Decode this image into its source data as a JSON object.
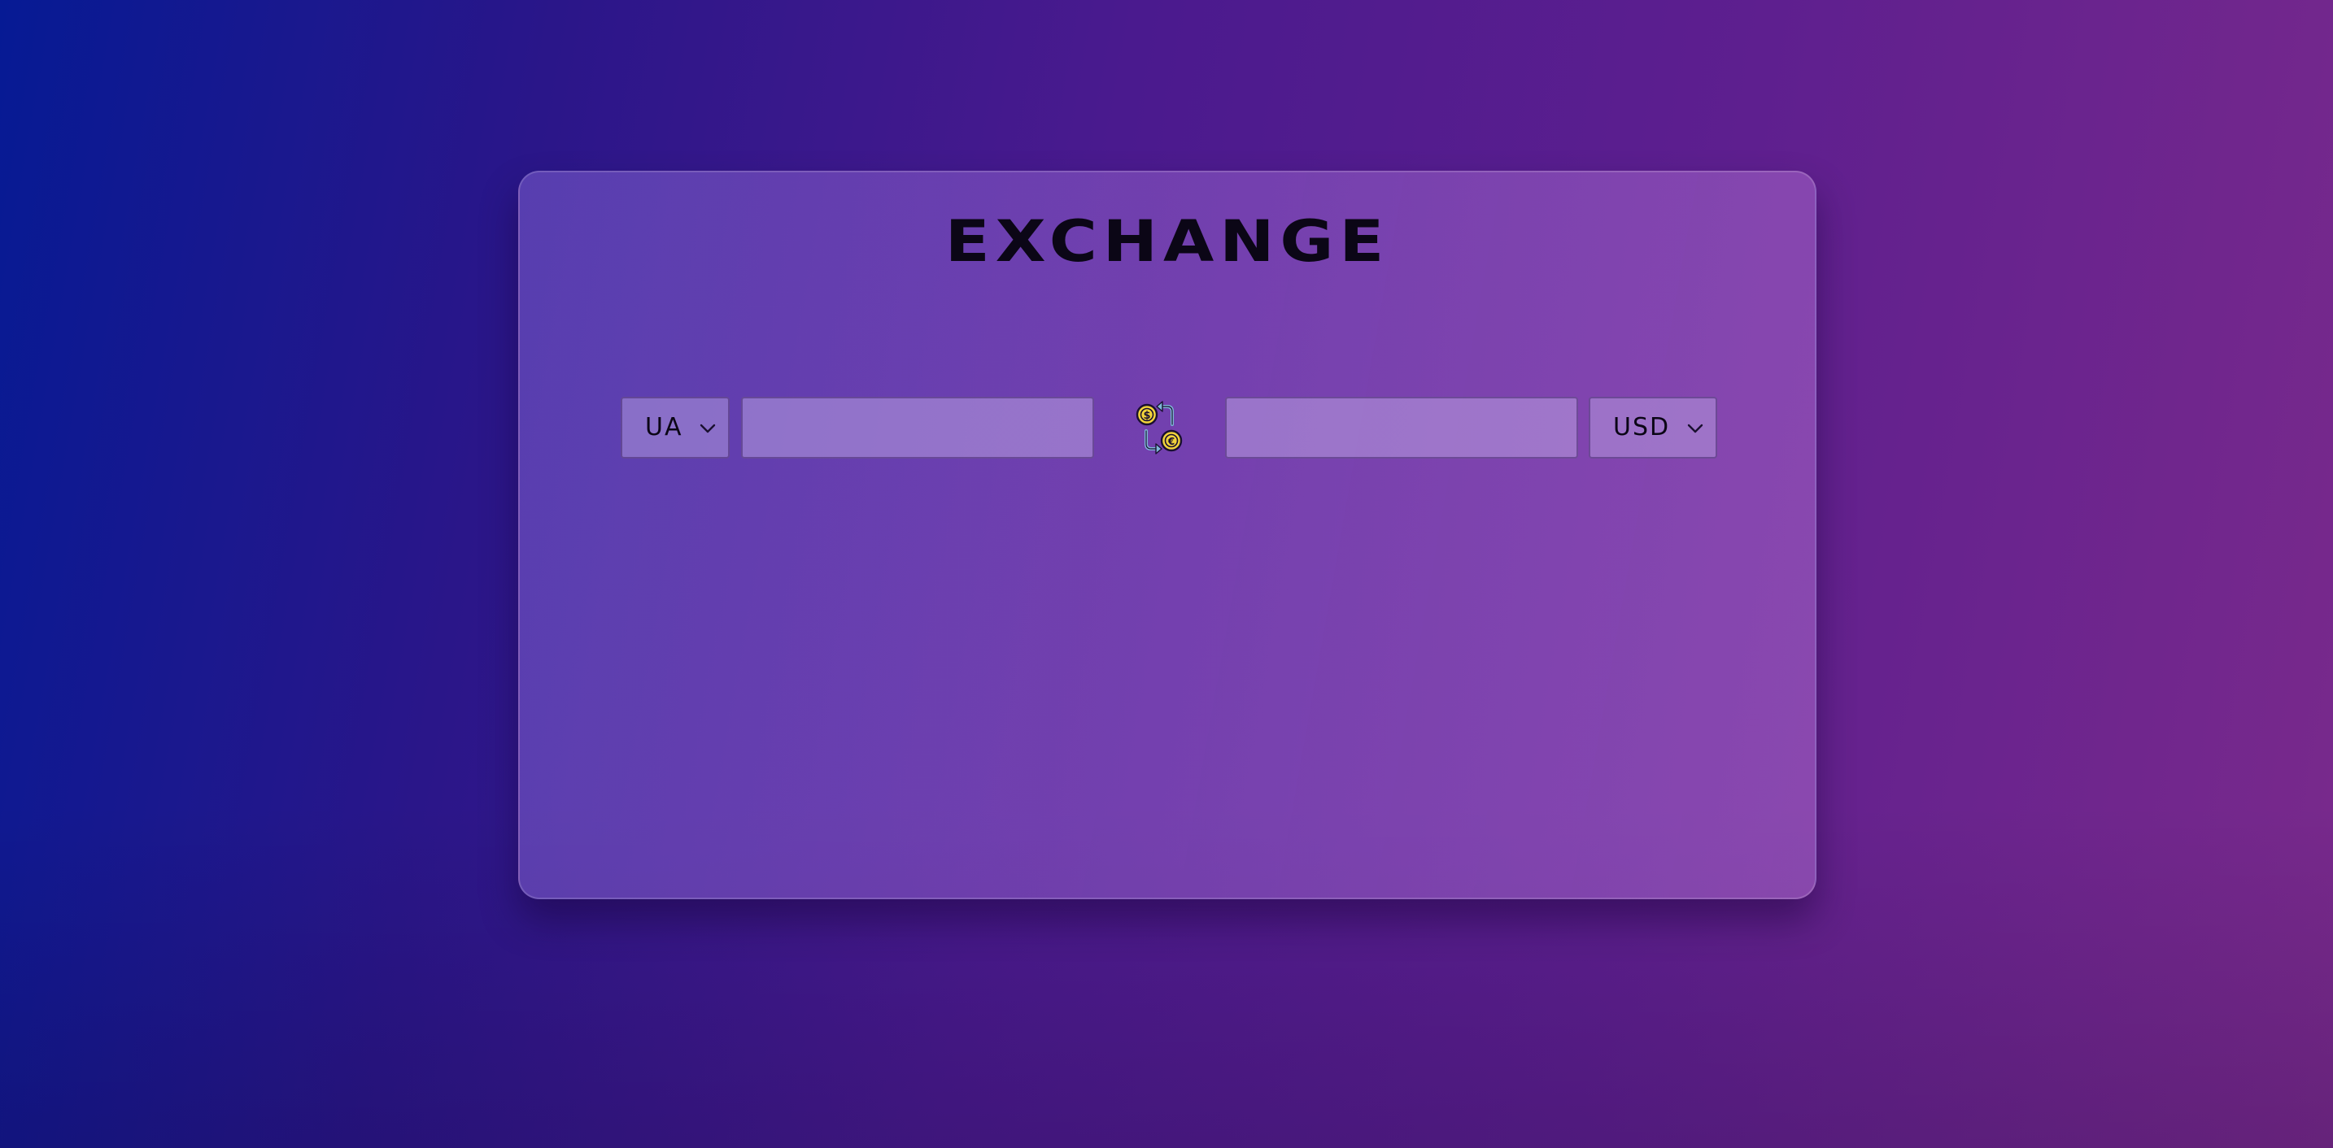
{
  "app": {
    "title": "EXCHANGE"
  },
  "converter": {
    "from_currency": {
      "selected": "UA"
    },
    "from_amount": {
      "value": "",
      "placeholder": ""
    },
    "swap_icon": "currency-exchange-icon",
    "to_amount": {
      "value": "",
      "placeholder": ""
    },
    "to_currency": {
      "selected": "USD"
    }
  },
  "colors": {
    "background_start": "#061a94",
    "background_end": "#7a2a8c",
    "coin_gold": "#f2d43a",
    "arrow_blue": "#7fb6d8",
    "text": "#0b0616"
  }
}
